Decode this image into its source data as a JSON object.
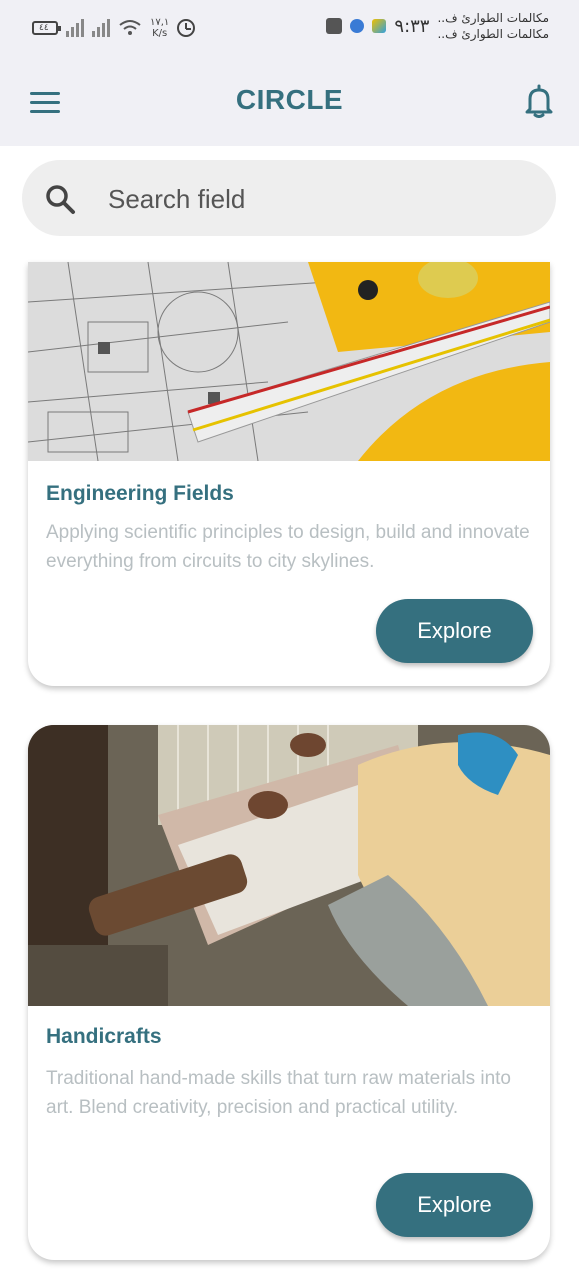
{
  "status_bar": {
    "battery_text": "٤٤",
    "speed_value": "١٧,١",
    "speed_unit": "K/s",
    "time": "٩:٣٣",
    "notification_line1": "مكالمات الطوارئ ف..",
    "notification_line2": "مكالمات الطوارئ ف.."
  },
  "app_bar": {
    "title": "CIRCLE",
    "menu_icon": "hamburger-menu-icon",
    "bell_icon": "bell-icon",
    "accent_color": "#35707f"
  },
  "search": {
    "placeholder": "Search field",
    "value": "",
    "icon": "search-icon"
  },
  "cards": [
    {
      "title": "Engineering Fields",
      "description": "Applying scientific principles to design, build and innovate everything from circuits to city skylines.",
      "button_label": "Explore",
      "image": "engineering-blueprint-image"
    },
    {
      "title": "Handicrafts",
      "description": "Traditional hand-made skills that turn raw materials into art. Blend creativity, precision and practical utility.",
      "button_label": "Explore",
      "image": "weaving-loom-image"
    }
  ]
}
